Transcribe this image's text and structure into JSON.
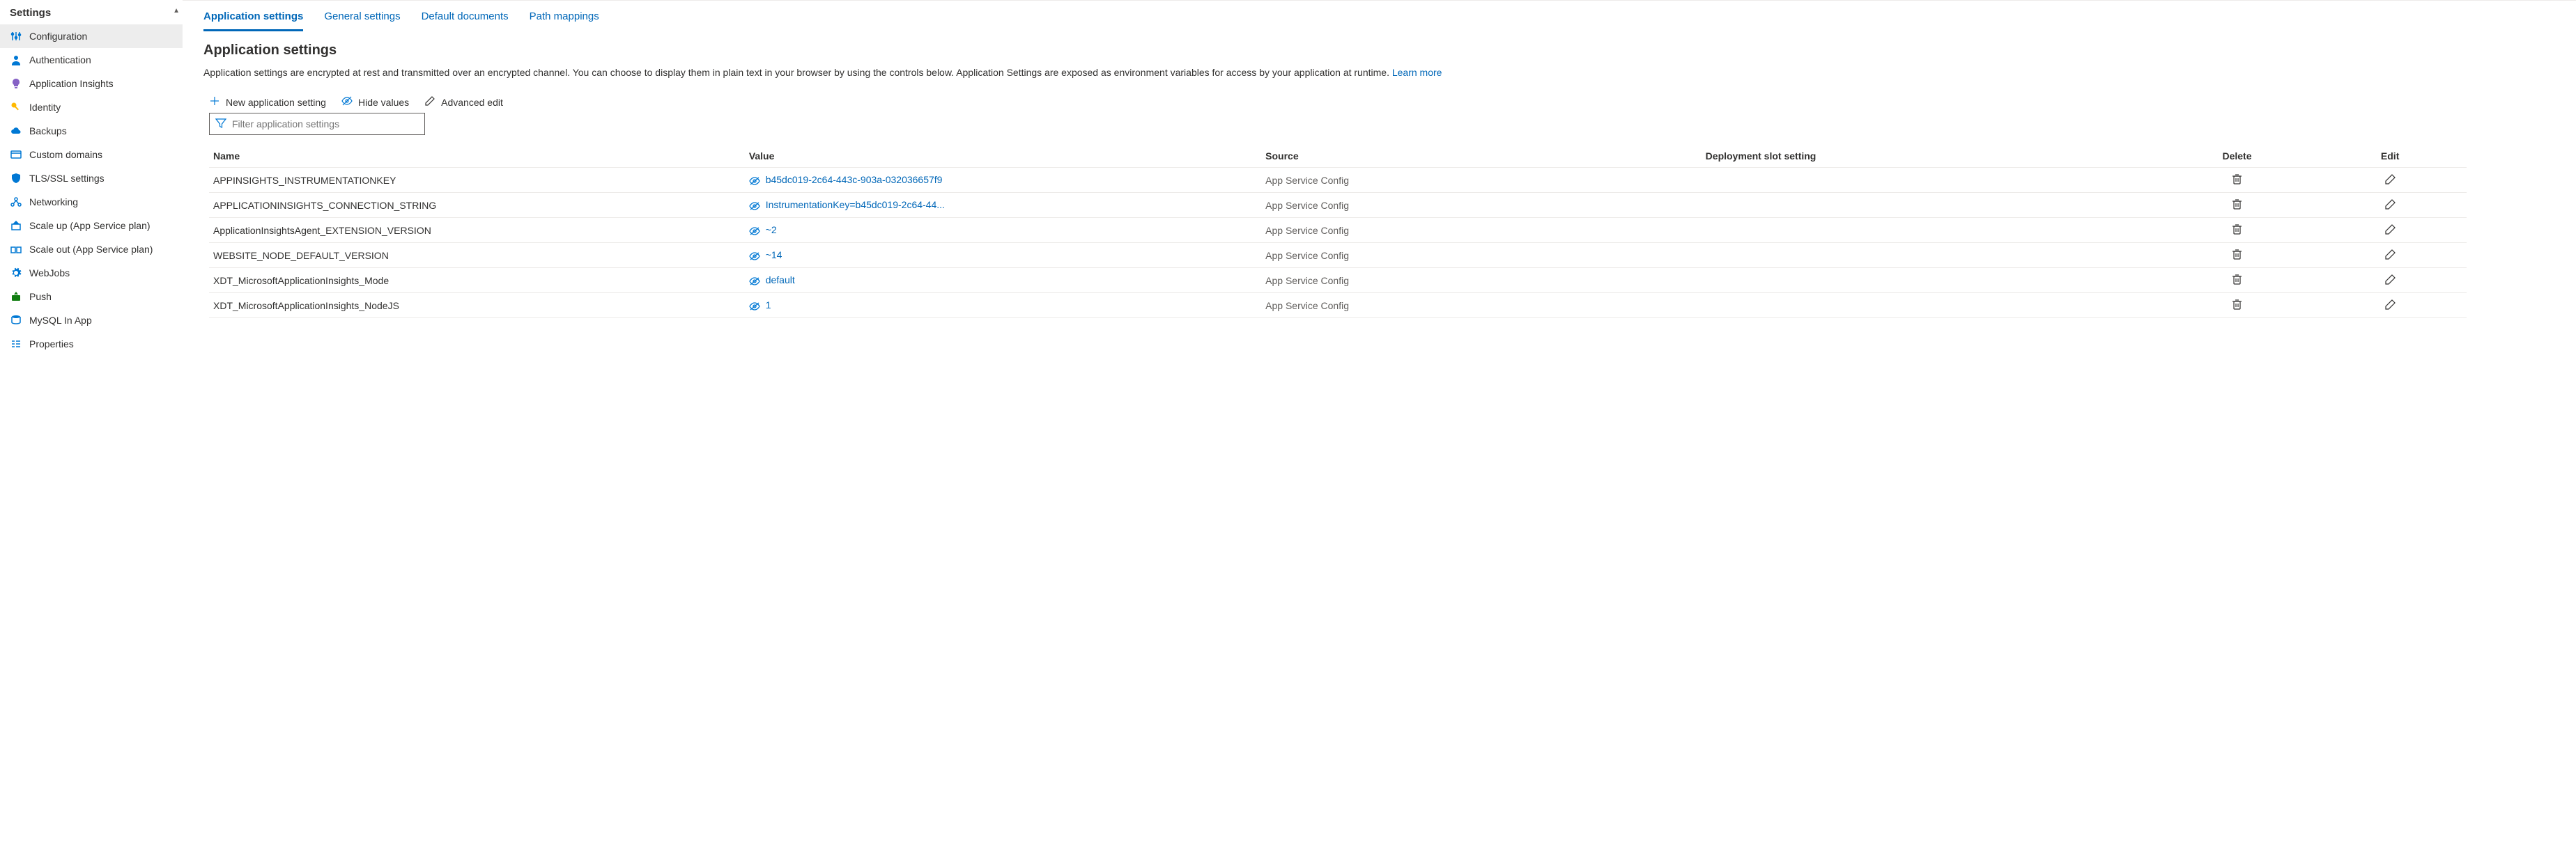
{
  "sidebar": {
    "title": "Settings",
    "items": [
      {
        "label": "Configuration",
        "icon": "sliders",
        "color": "#0078d4",
        "active": true
      },
      {
        "label": "Authentication",
        "icon": "person",
        "color": "#0078d4"
      },
      {
        "label": "Application Insights",
        "icon": "bulb",
        "color": "#8661c5"
      },
      {
        "label": "Identity",
        "icon": "key",
        "color": "#ffb900"
      },
      {
        "label": "Backups",
        "icon": "cloud",
        "color": "#0078d4"
      },
      {
        "label": "Custom domains",
        "icon": "domain",
        "color": "#0078d4"
      },
      {
        "label": "TLS/SSL settings",
        "icon": "shield",
        "color": "#0078d4"
      },
      {
        "label": "Networking",
        "icon": "network",
        "color": "#0078d4"
      },
      {
        "label": "Scale up (App Service plan)",
        "icon": "scaleup",
        "color": "#0078d4"
      },
      {
        "label": "Scale out (App Service plan)",
        "icon": "scaleout",
        "color": "#0078d4"
      },
      {
        "label": "WebJobs",
        "icon": "gear",
        "color": "#0078d4"
      },
      {
        "label": "Push",
        "icon": "push",
        "color": "#107c10"
      },
      {
        "label": "MySQL In App",
        "icon": "db",
        "color": "#0078d4"
      },
      {
        "label": "Properties",
        "icon": "props",
        "color": "#0078d4"
      }
    ]
  },
  "tabs": [
    {
      "label": "Application settings",
      "active": true
    },
    {
      "label": "General settings"
    },
    {
      "label": "Default documents"
    },
    {
      "label": "Path mappings"
    }
  ],
  "section": {
    "heading": "Application settings",
    "desc_pre": "Application settings are encrypted at rest and transmitted over an encrypted channel. You can choose to display them in plain text in your browser by using the controls below. Application Settings are exposed as environment variables for access by your application at runtime. ",
    "learn_more": "Learn more"
  },
  "actions": {
    "new": "New application setting",
    "hide": "Hide values",
    "adv": "Advanced edit"
  },
  "filter_placeholder": "Filter application settings",
  "columns": {
    "name": "Name",
    "value": "Value",
    "source": "Source",
    "slot": "Deployment slot setting",
    "delete": "Delete",
    "edit": "Edit"
  },
  "rows": [
    {
      "name": "APPINSIGHTS_INSTRUMENTATIONKEY",
      "value": "b45dc019-2c64-443c-903a-032036657f9",
      "source": "App Service Config"
    },
    {
      "name": "APPLICATIONINSIGHTS_CONNECTION_STRING",
      "value": "InstrumentationKey=b45dc019-2c64-44...",
      "source": "App Service Config"
    },
    {
      "name": "ApplicationInsightsAgent_EXTENSION_VERSION",
      "value": "~2",
      "source": "App Service Config"
    },
    {
      "name": "WEBSITE_NODE_DEFAULT_VERSION",
      "value": "~14",
      "source": "App Service Config"
    },
    {
      "name": "XDT_MicrosoftApplicationInsights_Mode",
      "value": "default",
      "source": "App Service Config"
    },
    {
      "name": "XDT_MicrosoftApplicationInsights_NodeJS",
      "value": "1",
      "source": "App Service Config"
    }
  ]
}
